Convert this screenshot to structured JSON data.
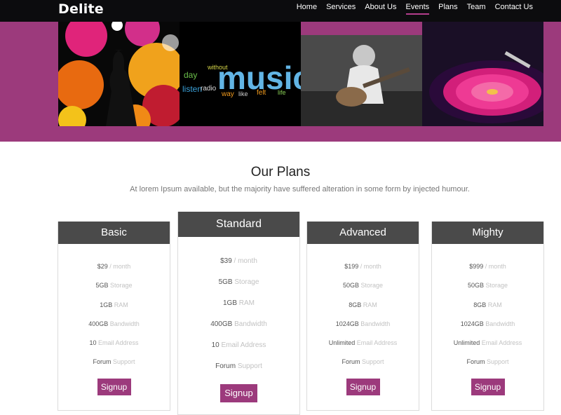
{
  "brand": {
    "name": "Delite"
  },
  "nav": {
    "items": [
      {
        "label": "Home"
      },
      {
        "label": "Services"
      },
      {
        "label": "About Us"
      },
      {
        "label": "Events",
        "active": true
      },
      {
        "label": "Plans"
      },
      {
        "label": "Team"
      },
      {
        "label": "Contact Us"
      }
    ]
  },
  "banner": {
    "images": [
      "concert-silhouette-image",
      "music-word-cloud-image",
      "guitar-player-image",
      "turntable-image"
    ],
    "wordcloud_text": "music"
  },
  "plans": {
    "title": "Our Plans",
    "subtitle": "At lorem Ipsum available, but the majority have suffered alteration in some form by injected humour.",
    "cards": [
      {
        "name": "Basic",
        "rows": [
          {
            "value": "$29",
            "label": "/ month"
          },
          {
            "value": "5GB",
            "label": "Storage"
          },
          {
            "value": "1GB",
            "label": "RAM"
          },
          {
            "value": "400GB",
            "label": "Bandwidth"
          },
          {
            "value": "10",
            "label": "Email Address"
          },
          {
            "value": "Forum",
            "label": "Support"
          }
        ],
        "button": "Signup"
      },
      {
        "name": "Standard",
        "featured": true,
        "rows": [
          {
            "value": "$39",
            "label": "/ month"
          },
          {
            "value": "5GB",
            "label": "Storage"
          },
          {
            "value": "1GB",
            "label": "RAM"
          },
          {
            "value": "400GB",
            "label": "Bandwidth"
          },
          {
            "value": "10",
            "label": "Email Address"
          },
          {
            "value": "Forum",
            "label": "Support"
          }
        ],
        "button": "Signup"
      },
      {
        "name": "Advanced",
        "rows": [
          {
            "value": "$199",
            "label": "/ month"
          },
          {
            "value": "50GB",
            "label": "Storage"
          },
          {
            "value": "8GB",
            "label": "RAM"
          },
          {
            "value": "1024GB",
            "label": "Bandwidth"
          },
          {
            "value": "Unlimited",
            "label": "Email Address"
          },
          {
            "value": "Forum",
            "label": "Support"
          }
        ],
        "button": "Signup"
      },
      {
        "name": "Mighty",
        "rows": [
          {
            "value": "$999",
            "label": "/ month"
          },
          {
            "value": "50GB",
            "label": "Storage"
          },
          {
            "value": "8GB",
            "label": "RAM"
          },
          {
            "value": "1024GB",
            "label": "Bandwidth"
          },
          {
            "value": "Unlimited",
            "label": "Email Address"
          },
          {
            "value": "Forum",
            "label": "Support"
          }
        ],
        "button": "Signup"
      }
    ]
  },
  "colors": {
    "accent": "#9c3a7c",
    "header_bg": "#0c0c0e",
    "card_head": "#4a4a4a"
  }
}
